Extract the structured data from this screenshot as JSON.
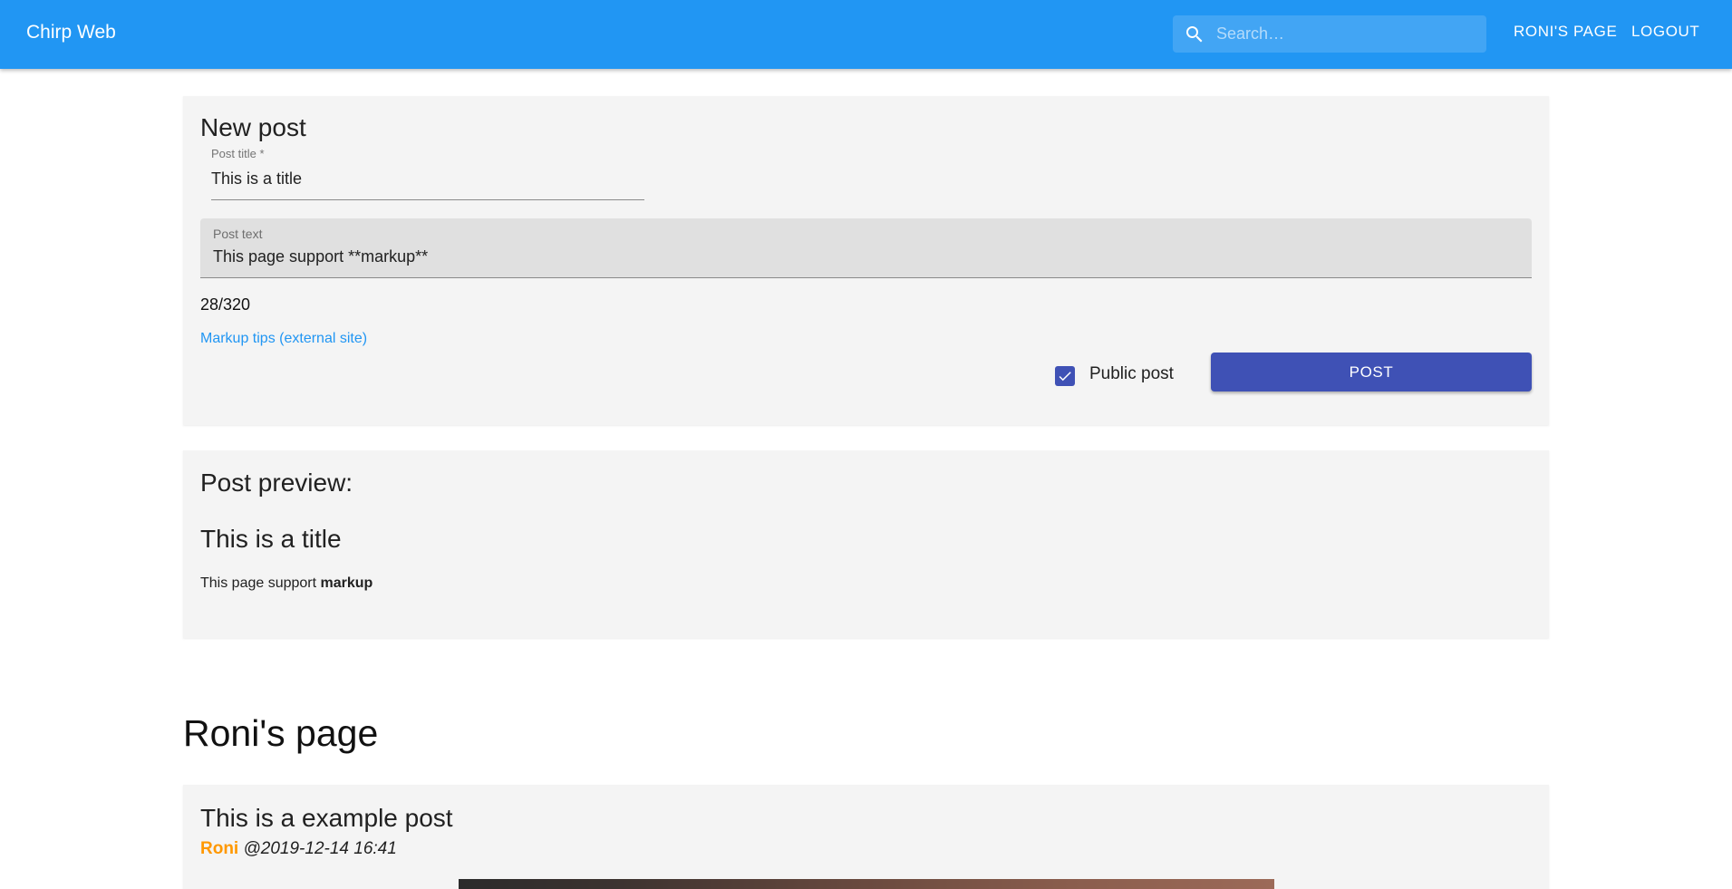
{
  "header": {
    "app_title": "Chirp Web",
    "search_placeholder": "Search…",
    "nav": {
      "roni_page": "RONI'S PAGE",
      "logout": "LOGOUT"
    },
    "search_icon": "search-icon"
  },
  "new_post": {
    "heading": "New post",
    "title_label": "Post title *",
    "title_value": "This is a title",
    "text_label": "Post text",
    "text_value": "This page support **markup**",
    "counter": "28/320",
    "markup_link": "Markup tips (external site)",
    "public_checked": true,
    "public_label": "Public post",
    "post_button": "POST"
  },
  "preview": {
    "heading": "Post preview:",
    "title": "This is a title",
    "body_plain": "This page support ",
    "body_bold": "markup"
  },
  "page": {
    "heading": "Roni's page"
  },
  "example_post": {
    "title": "This is a example post",
    "author": "Roni",
    "timestamp": "@2019-12-14 16:41"
  },
  "colors": {
    "appbar": "#2196f3",
    "primary_button": "#3f51b5",
    "link": "#2196f3",
    "author": "#ff9800",
    "card": "#f4f4f4"
  }
}
